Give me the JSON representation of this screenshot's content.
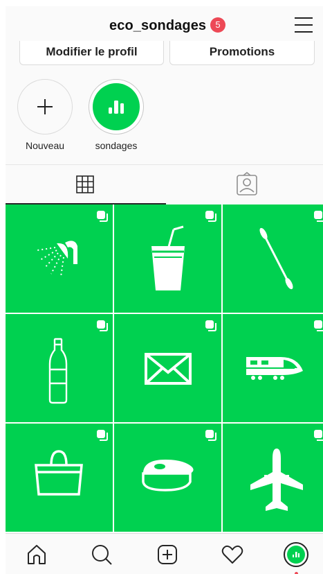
{
  "header": {
    "username": "eco_sondages",
    "notification_count": "5"
  },
  "profile_buttons": {
    "edit": "Modifier le profil",
    "promotions": "Promotions"
  },
  "highlights": [
    {
      "label": "Nouveau",
      "icon": "plus-icon"
    },
    {
      "label": "sondages",
      "icon": "bar-chart-icon"
    }
  ],
  "tabs": [
    {
      "name": "grid",
      "icon": "grid-icon",
      "active": true
    },
    {
      "name": "tagged",
      "icon": "tagged-person-icon",
      "active": false
    }
  ],
  "posts": [
    {
      "icon": "shower-head-icon",
      "multi": true
    },
    {
      "icon": "plastic-cup-straw-icon",
      "multi": true
    },
    {
      "icon": "cotton-swab-icon",
      "multi": true
    },
    {
      "icon": "plastic-bottle-icon",
      "multi": true
    },
    {
      "icon": "envelope-icon",
      "multi": true
    },
    {
      "icon": "high-speed-train-icon",
      "multi": true
    },
    {
      "icon": "shopping-bag-icon",
      "multi": true
    },
    {
      "icon": "steak-icon",
      "multi": true
    },
    {
      "icon": "airplane-icon",
      "multi": true
    }
  ],
  "bottom_nav": [
    "home-icon",
    "search-icon",
    "new-post-icon",
    "heart-icon",
    "profile-avatar"
  ],
  "colors": {
    "brand_green": "#00d150",
    "badge_red": "#ed4956"
  }
}
